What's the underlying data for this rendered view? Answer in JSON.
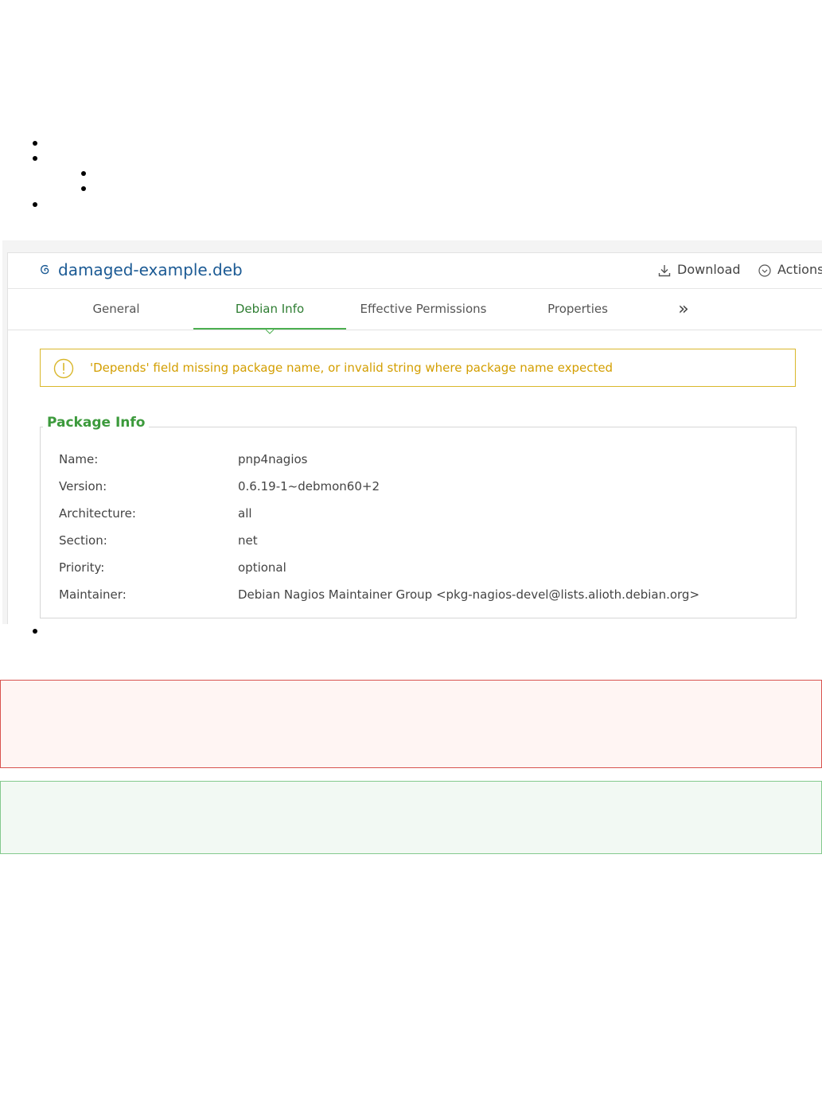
{
  "file": {
    "title": "damaged-example.deb"
  },
  "header_actions": {
    "download_label": "Download",
    "actions_label": "Actions"
  },
  "tabs": [
    {
      "label": "General",
      "active": false
    },
    {
      "label": "Debian Info",
      "active": true
    },
    {
      "label": "Effective Permissions",
      "active": false
    },
    {
      "label": "Properties",
      "active": false
    }
  ],
  "more_tabs_glyph": "»",
  "warning": {
    "icon": "exclamation-circle-icon",
    "message": "'Depends' field missing package name, or invalid string where package name expected",
    "color": "#d39e00"
  },
  "package_info": {
    "title": "Package Info",
    "rows": [
      {
        "label": "Name:",
        "value": "pnp4nagios"
      },
      {
        "label": "Version:",
        "value": "0.6.19-1~debmon60+2"
      },
      {
        "label": "Architecture:",
        "value": "all"
      },
      {
        "label": "Section:",
        "value": "net"
      },
      {
        "label": "Priority:",
        "value": "optional"
      },
      {
        "label": "Maintainer:",
        "value": "Debian Nagios Maintainer Group <pkg-nagios-devel@lists.alioth.debian.org>"
      }
    ]
  },
  "colors": {
    "title_blue": "#1b5a94",
    "active_tab_green": "#2e7d32",
    "legend_green": "#3c9a3c",
    "error_border": "#d8524e",
    "success_border": "#84c98d"
  }
}
